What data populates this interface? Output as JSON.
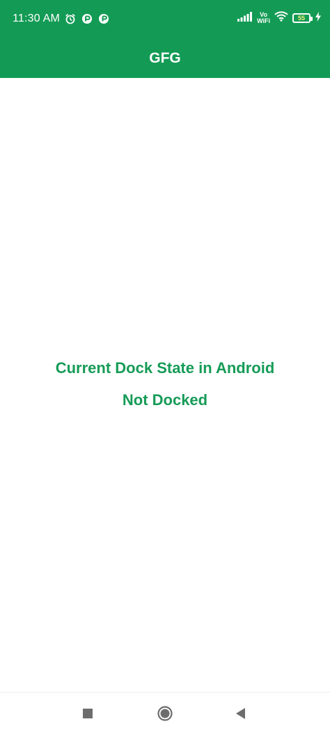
{
  "status_bar": {
    "time": "11:30 AM",
    "left_icons": [
      "alarm-icon",
      "app-notification-icon",
      "app-notification-icon"
    ],
    "right_icons": [
      "signal-icon",
      "volte-wifi-icon",
      "wifi-icon",
      "battery-icon",
      "charging-icon"
    ],
    "volte_line1": "Vo",
    "volte_line2": "WiFi",
    "battery_level": "55"
  },
  "app_bar": {
    "title": "GFG"
  },
  "main": {
    "heading": "Current Dock State in Android",
    "dock_state": "Not Docked"
  },
  "nav_bar": {
    "buttons": [
      "recents-icon",
      "home-icon",
      "back-icon"
    ]
  },
  "colors": {
    "primary": "#139b55",
    "text_accent": "#169b57",
    "background": "#ffffff",
    "nav_icons": "#6d6d6d"
  }
}
